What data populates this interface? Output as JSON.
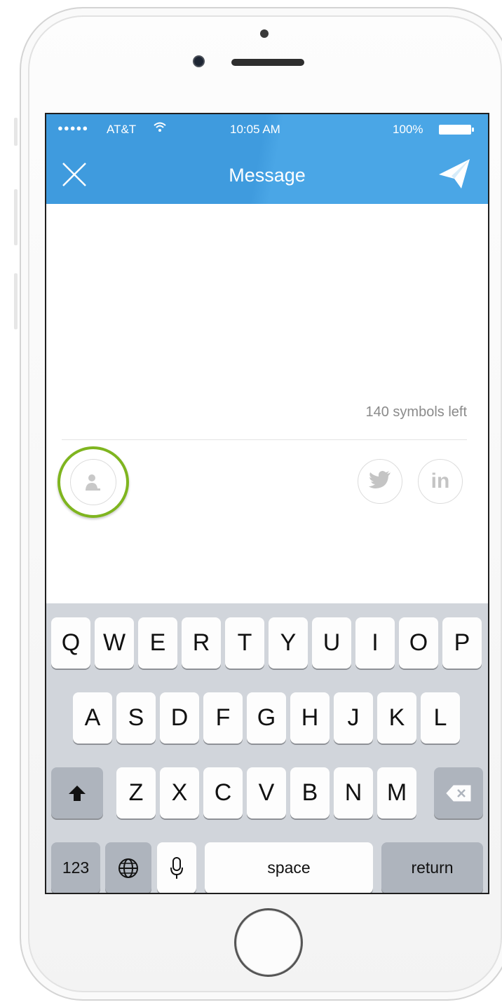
{
  "status_bar": {
    "signal_dots": "●●●●●",
    "carrier": "AT&T",
    "time": "10:05 AM",
    "battery": "100%"
  },
  "nav": {
    "title": "Message",
    "close_icon": "close-icon",
    "send_icon": "send-icon"
  },
  "compose": {
    "counter": "140 symbols left"
  },
  "share": {
    "contact_icon": "person-icon",
    "twitter_icon": "twitter-icon",
    "linkedin_label": "in"
  },
  "keyboard": {
    "row1": [
      "Q",
      "W",
      "E",
      "R",
      "T",
      "Y",
      "U",
      "I",
      "O",
      "P"
    ],
    "row2": [
      "A",
      "S",
      "D",
      "F",
      "G",
      "H",
      "J",
      "K",
      "L"
    ],
    "row3": [
      "Z",
      "X",
      "C",
      "V",
      "B",
      "N",
      "M"
    ],
    "numbers": "123",
    "space": "space",
    "return": "return"
  },
  "colors": {
    "header": "#3f9bde",
    "accent_ring": "#7fb51f",
    "keyboard_bg": "#d1d5db"
  }
}
